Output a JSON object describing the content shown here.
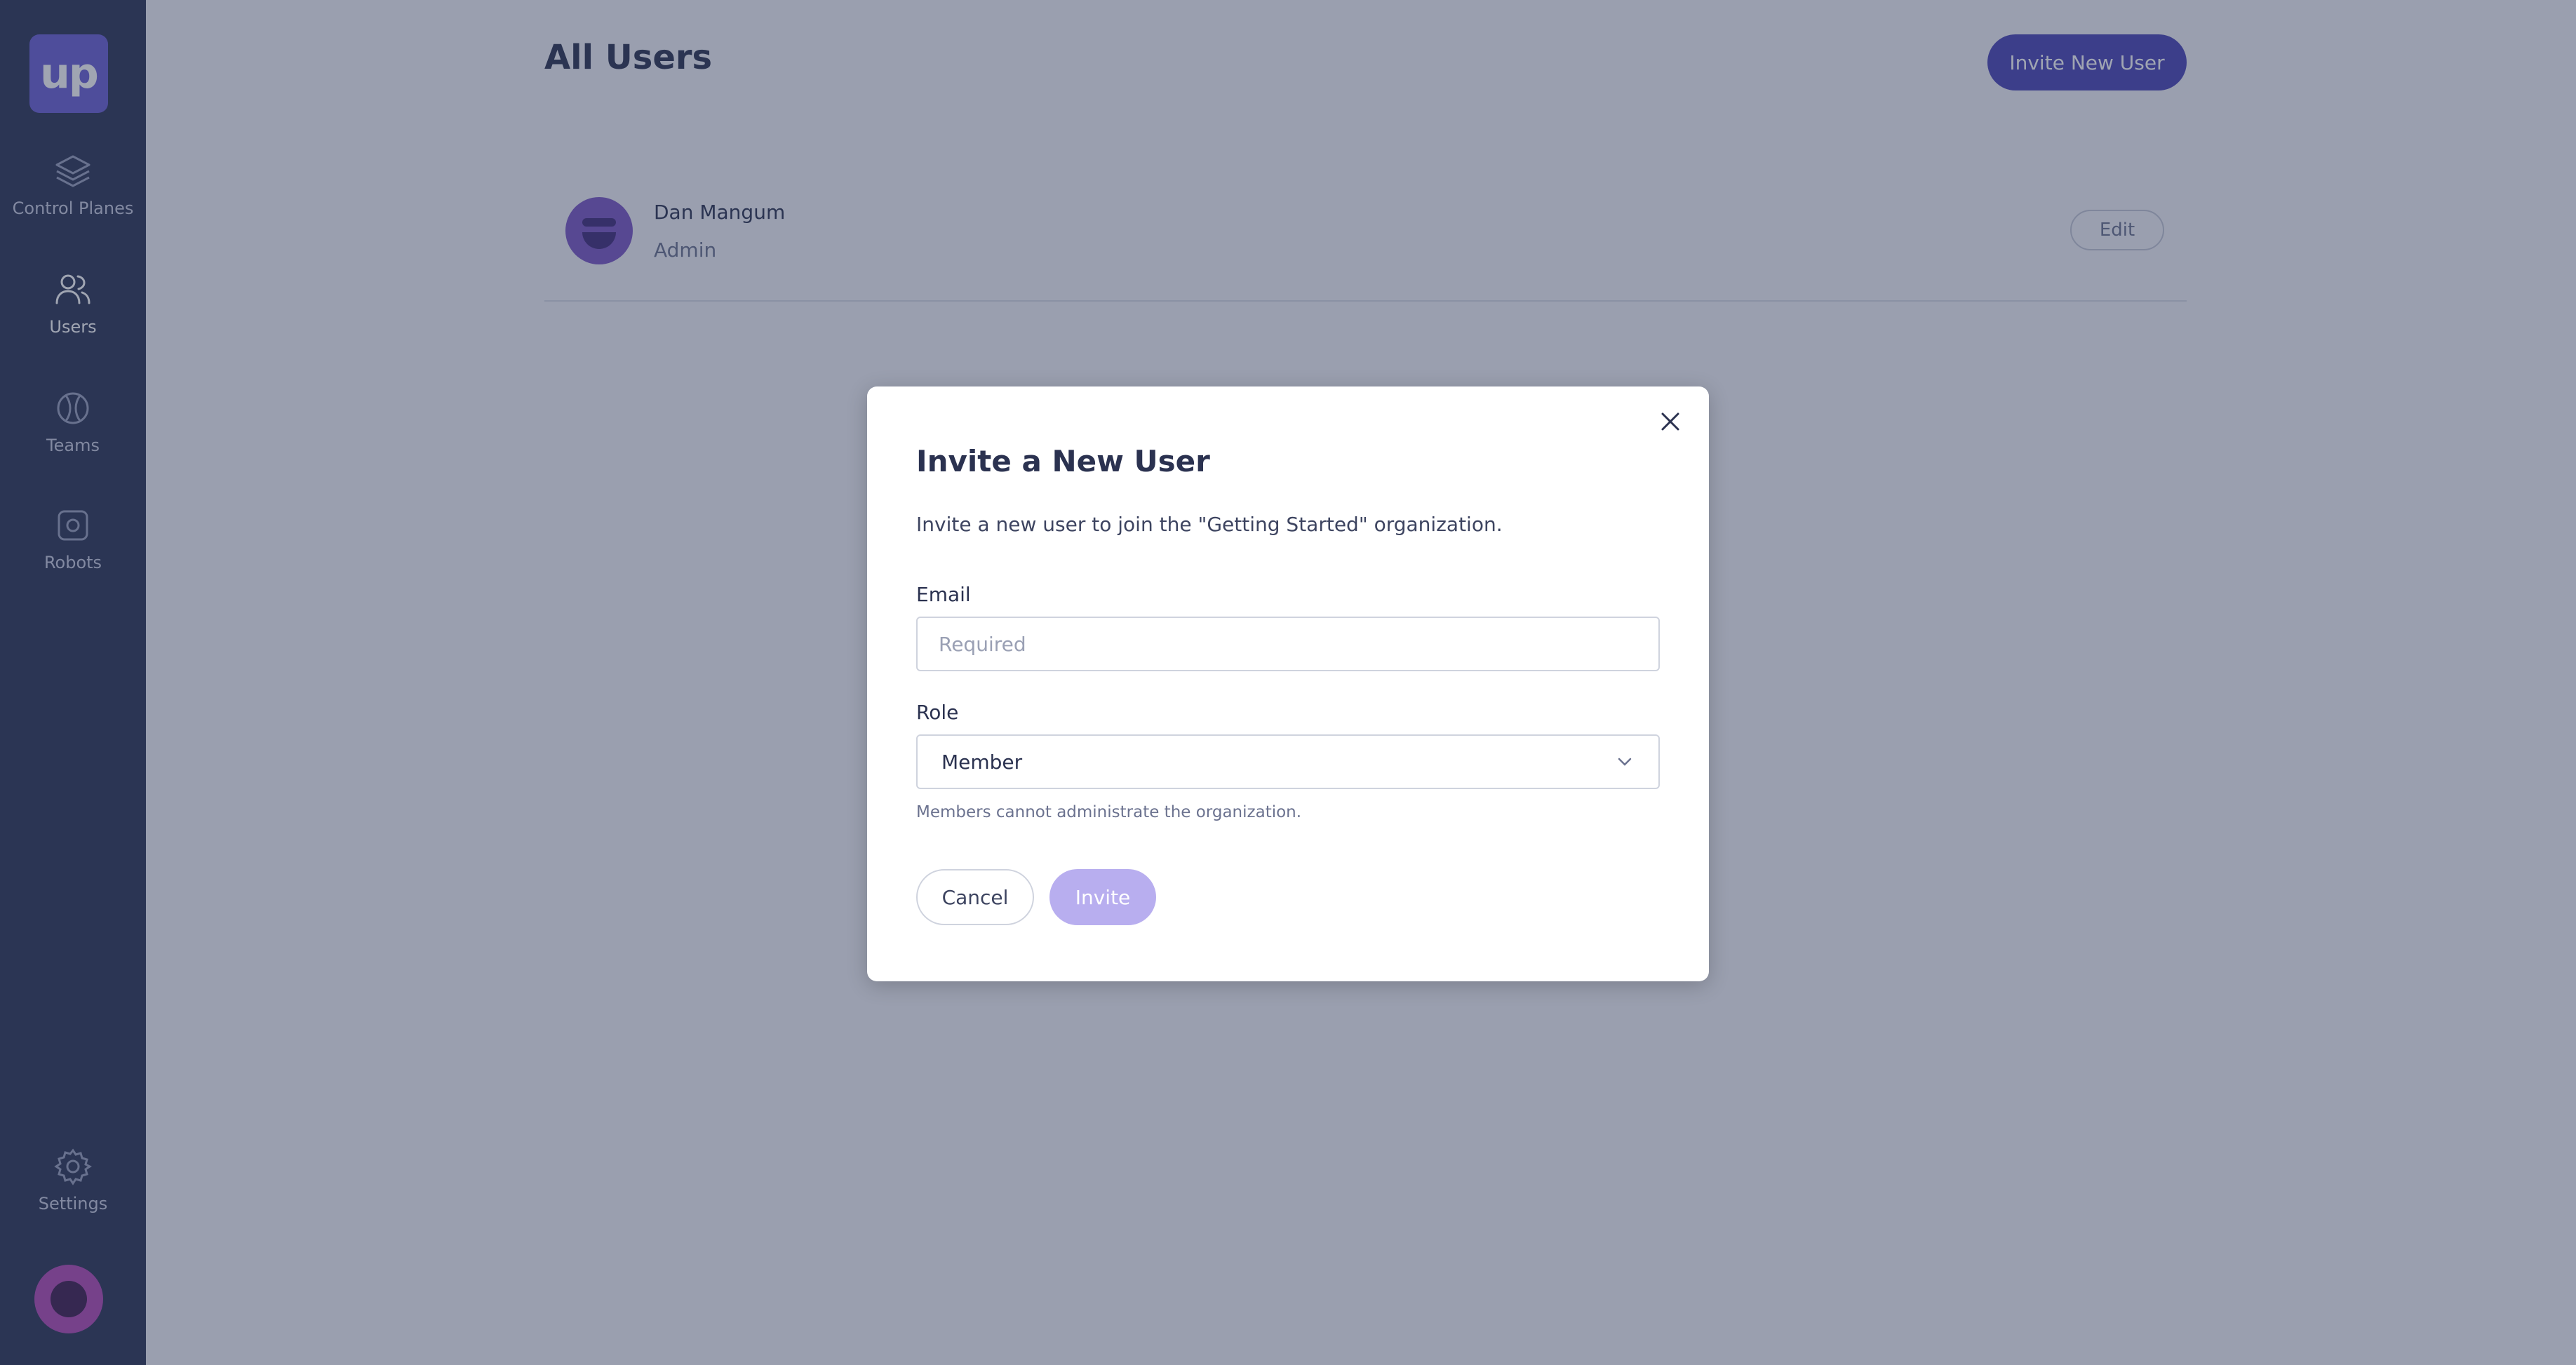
{
  "brand": {
    "logo_text": "up"
  },
  "sidebar": {
    "items": [
      {
        "label": "Control Planes",
        "icon": "layers-icon"
      },
      {
        "label": "Users",
        "icon": "users-icon",
        "active": true
      },
      {
        "label": "Teams",
        "icon": "teams-icon"
      },
      {
        "label": "Robots",
        "icon": "robot-icon"
      }
    ],
    "settings": {
      "label": "Settings",
      "icon": "gear-icon"
    }
  },
  "page": {
    "title": "All Users",
    "invite_button": "Invite New User"
  },
  "users": [
    {
      "name": "Dan Mangum",
      "role": "Admin",
      "edit_label": "Edit"
    }
  ],
  "modal": {
    "title": "Invite a New User",
    "description": "Invite a new user to join the \"Getting Started\" organization.",
    "email_label": "Email",
    "email_placeholder": "Required",
    "role_label": "Role",
    "role_value": "Member",
    "helper": "Members cannot administrate the organization.",
    "cancel": "Cancel",
    "invite": "Invite"
  },
  "colors": {
    "sidebar": "#2a3354",
    "accent": "#4a44b6",
    "logo": "#6b5fd6",
    "invite_disabled": "#b8aeef"
  }
}
